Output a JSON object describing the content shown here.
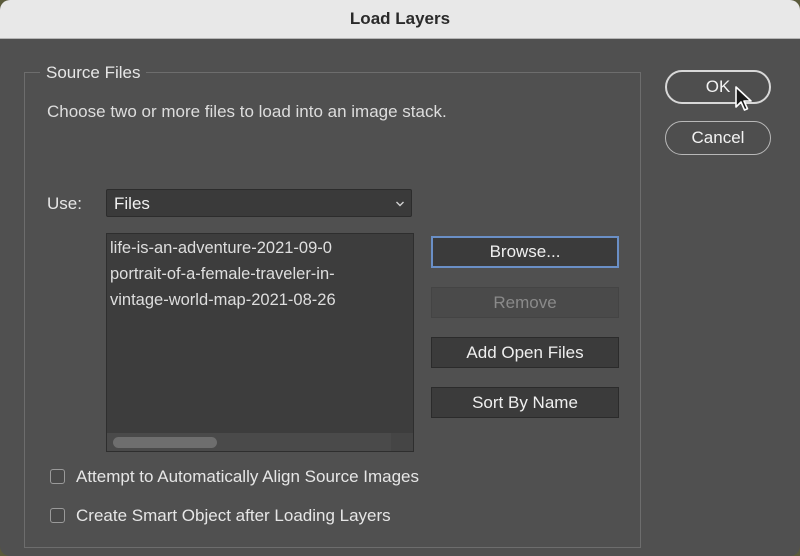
{
  "window": {
    "title": "Load Layers"
  },
  "source_files": {
    "group_label": "Source Files",
    "description": "Choose two or more files to load into an image stack.",
    "use_label": "Use:",
    "use_value": "Files",
    "files": [
      "life-is-an-adventure-2021-09-0",
      "portrait-of-a-female-traveler-in-",
      "vintage-world-map-2021-08-26"
    ],
    "buttons": {
      "browse": "Browse...",
      "remove": "Remove",
      "add_open_files": "Add Open Files",
      "sort_by_name": "Sort By Name"
    }
  },
  "options": {
    "auto_align": {
      "label": "Attempt to Automatically Align Source Images",
      "checked": false
    },
    "smart_object": {
      "label": "Create Smart Object after Loading Layers",
      "checked": false
    }
  },
  "actions": {
    "ok": "OK",
    "cancel": "Cancel"
  }
}
